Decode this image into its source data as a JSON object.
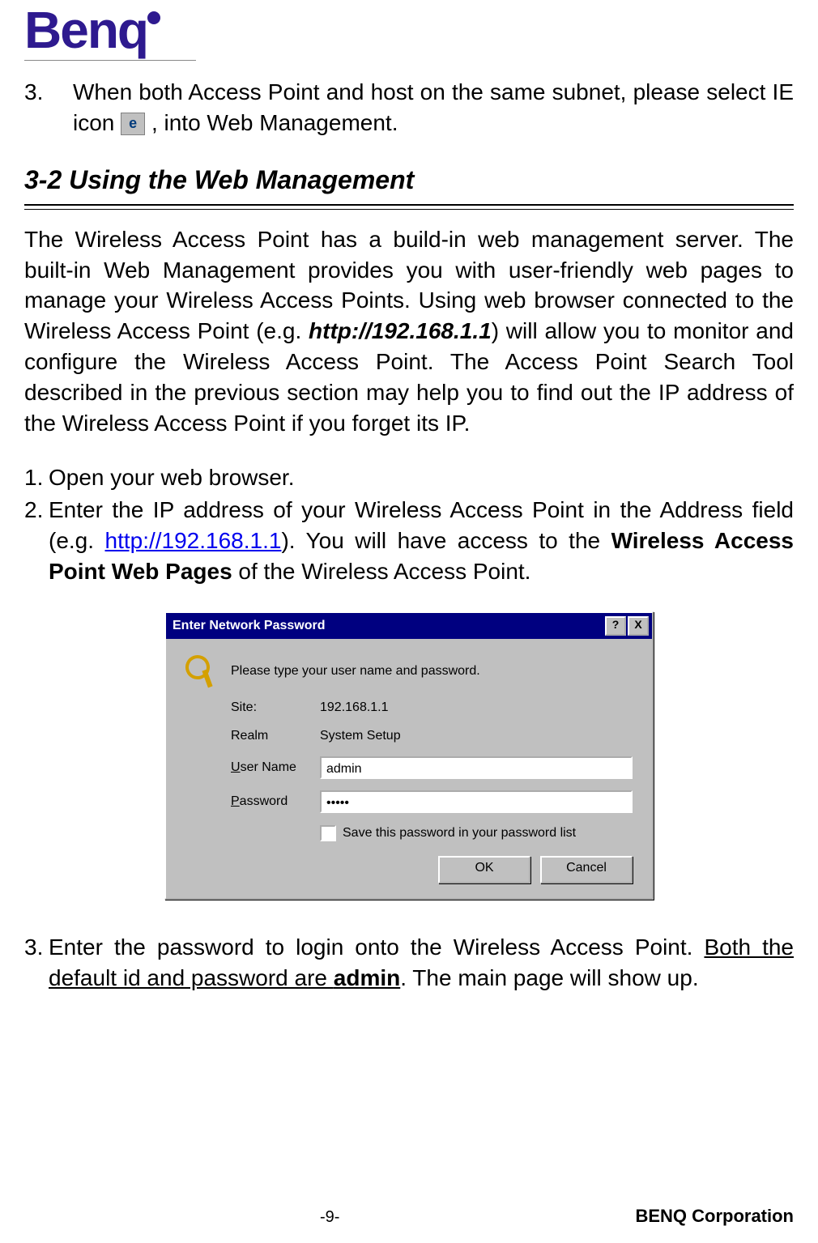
{
  "logo_text": "Benq",
  "step3_num": "3.",
  "step3_part1": "When both Access Point and host on the same subnet, please select IE icon ",
  "step3_part2": ", into Web Management.",
  "ie_icon_label": "e",
  "heading_3_2": "3-2 Using the Web Management",
  "intro_p1_a": "The Wireless Access Point has a build-in web management server. The built-in Web Management provides you with user-friendly web pages to manage your Wireless Access Points. Using web browser connected to the Wireless Access Point (e.g. ",
  "intro_url_bold": "http://192.168.1.1",
  "intro_p1_b": ") will allow you to monitor and configure the Wireless Access Point. The Access Point Search Tool described in the previous section may help you to find out the IP address of the Wireless Access Point if you forget its IP.",
  "steps": {
    "one_num": "1.",
    "one_text": "Open your web browser.",
    "two_num": "2.",
    "two_a": "Enter the IP address of your Wireless Access Point in the Address field (e.g. ",
    "two_link": "http://192.168.1.1",
    "two_b": ").   You will have access to the ",
    "two_bold": "Wireless Access Point Web Pages",
    "two_c": " of the Wireless Access Point."
  },
  "dialog": {
    "title": "Enter Network Password",
    "help_btn": "?",
    "close_btn": "X",
    "prompt": "Please type your user name and password.",
    "site_label": "Site:",
    "site_value": "192.168.1.1",
    "realm_label": "Realm",
    "realm_value": "System Setup",
    "user_label_pre": "U",
    "user_label_post": "ser Name",
    "user_value": "admin",
    "pass_label_pre": "P",
    "pass_label_post": "assword",
    "pass_value": "•••••",
    "save_pre": "S",
    "save_post": "ave this password in your password list",
    "ok": "OK",
    "cancel": "Cancel"
  },
  "step3b_num": "3.",
  "step3b_a": "Enter the password to login onto the Wireless Access Point. ",
  "step3b_u_a": "Both the default id and password are ",
  "step3b_u_bold": "admin",
  "step3b_b": ".    The main page will show up.",
  "page_number": "-9-",
  "corp": "BENQ Corporation"
}
